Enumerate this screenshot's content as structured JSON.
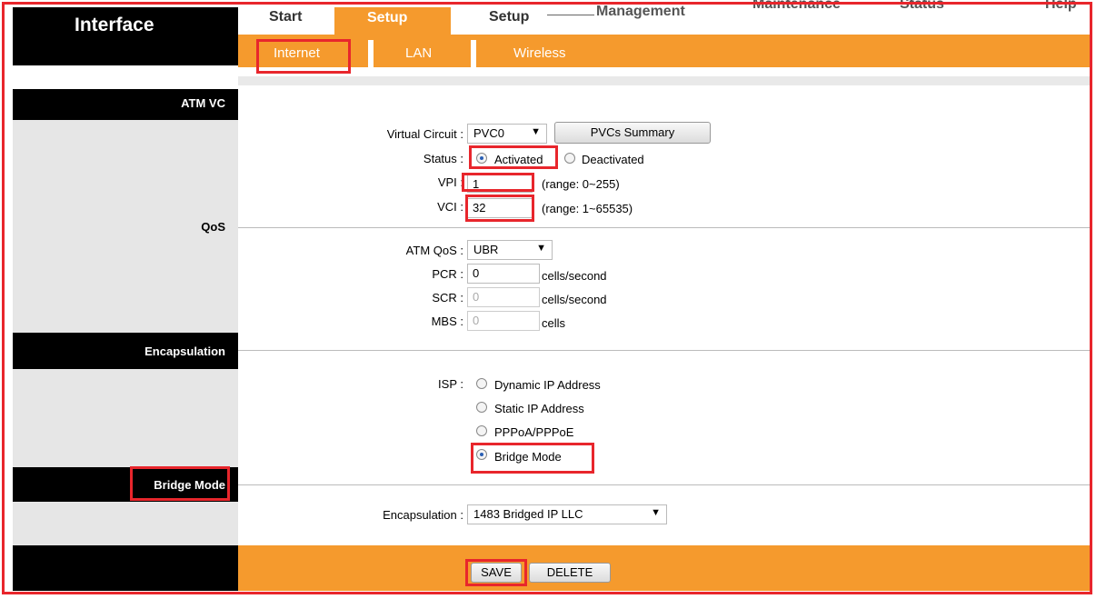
{
  "brand": "Interface",
  "nav": {
    "tabs": [
      "Start",
      "Setup",
      "Setup",
      "Management",
      "Maintenance",
      "Status",
      "Help"
    ],
    "subtabs": [
      "Internet",
      "LAN",
      "Wireless"
    ]
  },
  "sections": {
    "atm_vc": "ATM VC",
    "qos": "QoS",
    "encapsulation": "Encapsulation",
    "bridge_mode": "Bridge Mode"
  },
  "atm": {
    "virtual_circuit_label": "Virtual Circuit :",
    "virtual_circuit_value": "PVC0",
    "pvcs_summary": "PVCs Summary",
    "status_label": "Status :",
    "status_options": [
      "Activated",
      "Deactivated"
    ],
    "status_selected": "Activated",
    "vpi_label": "VPI :",
    "vpi_value": "1",
    "vpi_range": "(range: 0~255)",
    "vci_label": "VCI :",
    "vci_value": "32",
    "vci_range": "(range: 1~65535)"
  },
  "qos": {
    "atm_qos_label": "ATM QoS :",
    "atm_qos_value": "UBR",
    "pcr_label": "PCR :",
    "pcr_value": "0",
    "pcr_unit": "cells/second",
    "scr_label": "SCR :",
    "scr_value": "0",
    "scr_unit": "cells/second",
    "mbs_label": "MBS :",
    "mbs_value": "0",
    "mbs_unit": "cells"
  },
  "isp": {
    "label": "ISP :",
    "options": [
      "Dynamic IP Address",
      "Static IP Address",
      "PPPoA/PPPoE",
      "Bridge Mode"
    ],
    "selected": "Bridge Mode"
  },
  "bridge": {
    "encapsulation_label": "Encapsulation :",
    "encapsulation_value": "1483 Bridged IP LLC"
  },
  "footer": {
    "save": "SAVE",
    "delete": "DELETE"
  },
  "colors": {
    "accent_orange": "#f59a2d",
    "highlight_red": "#e8262c",
    "sidebar_black": "#000000",
    "sidebar_grey": "#e6e6e6"
  },
  "icons": {
    "dropdown": "chevron-down-icon",
    "radio": "radio-icon"
  }
}
